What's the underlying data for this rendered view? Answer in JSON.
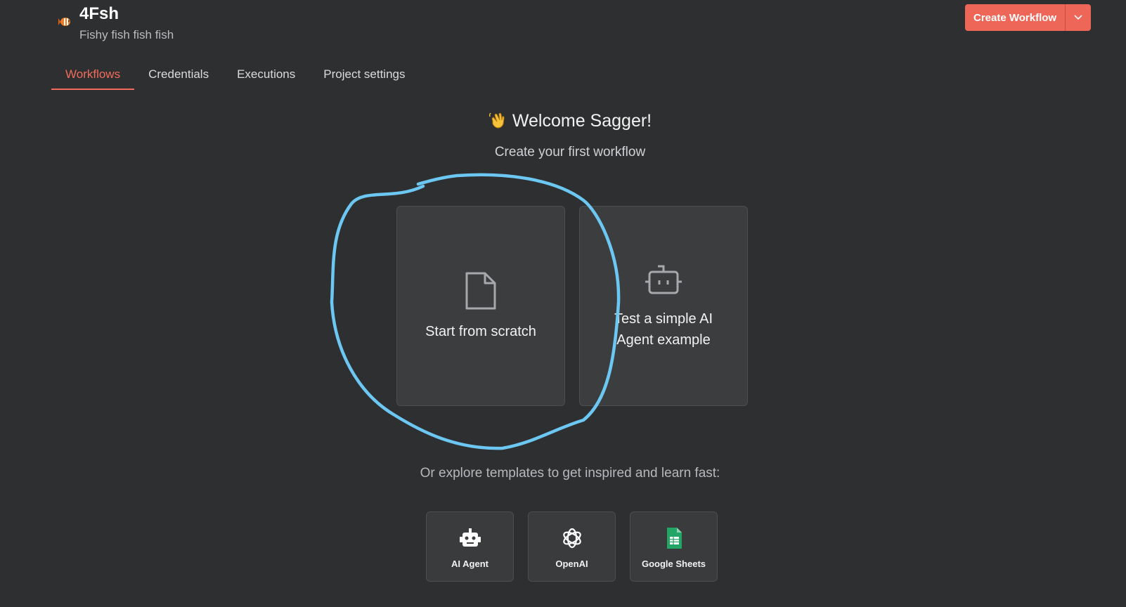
{
  "project": {
    "title": "4Fsh",
    "subtitle": "Fishy fish fish fish",
    "icon": "fish-emoji-icon"
  },
  "header": {
    "create_label": "Create Workflow",
    "create_caret_icon": "chevron-down-icon",
    "accent_color": "#ee6657"
  },
  "tabs": [
    {
      "label": "Workflows",
      "active": true
    },
    {
      "label": "Credentials",
      "active": false
    },
    {
      "label": "Executions",
      "active": false
    },
    {
      "label": "Project settings",
      "active": false
    }
  ],
  "main": {
    "welcome_icon": "waving-hand-icon",
    "welcome": "Welcome Sagger!",
    "subtitle": "Create your first workflow",
    "cards": [
      {
        "label": "Start from scratch",
        "icon": "file-icon"
      },
      {
        "label": "Test a simple AI Agent example",
        "icon": "robot-icon"
      }
    ],
    "explore": "Or explore templates to get inspired and learn fast:",
    "templates": [
      {
        "label": "AI Agent",
        "icon": "robot-icon"
      },
      {
        "label": "OpenAI",
        "icon": "openai-icon"
      },
      {
        "label": "Google Sheets",
        "icon": "google-sheets-icon"
      }
    ]
  },
  "annotation": {
    "shape": "hand-drawn-circle",
    "color": "#6cc7f2",
    "target": "Start from scratch"
  }
}
